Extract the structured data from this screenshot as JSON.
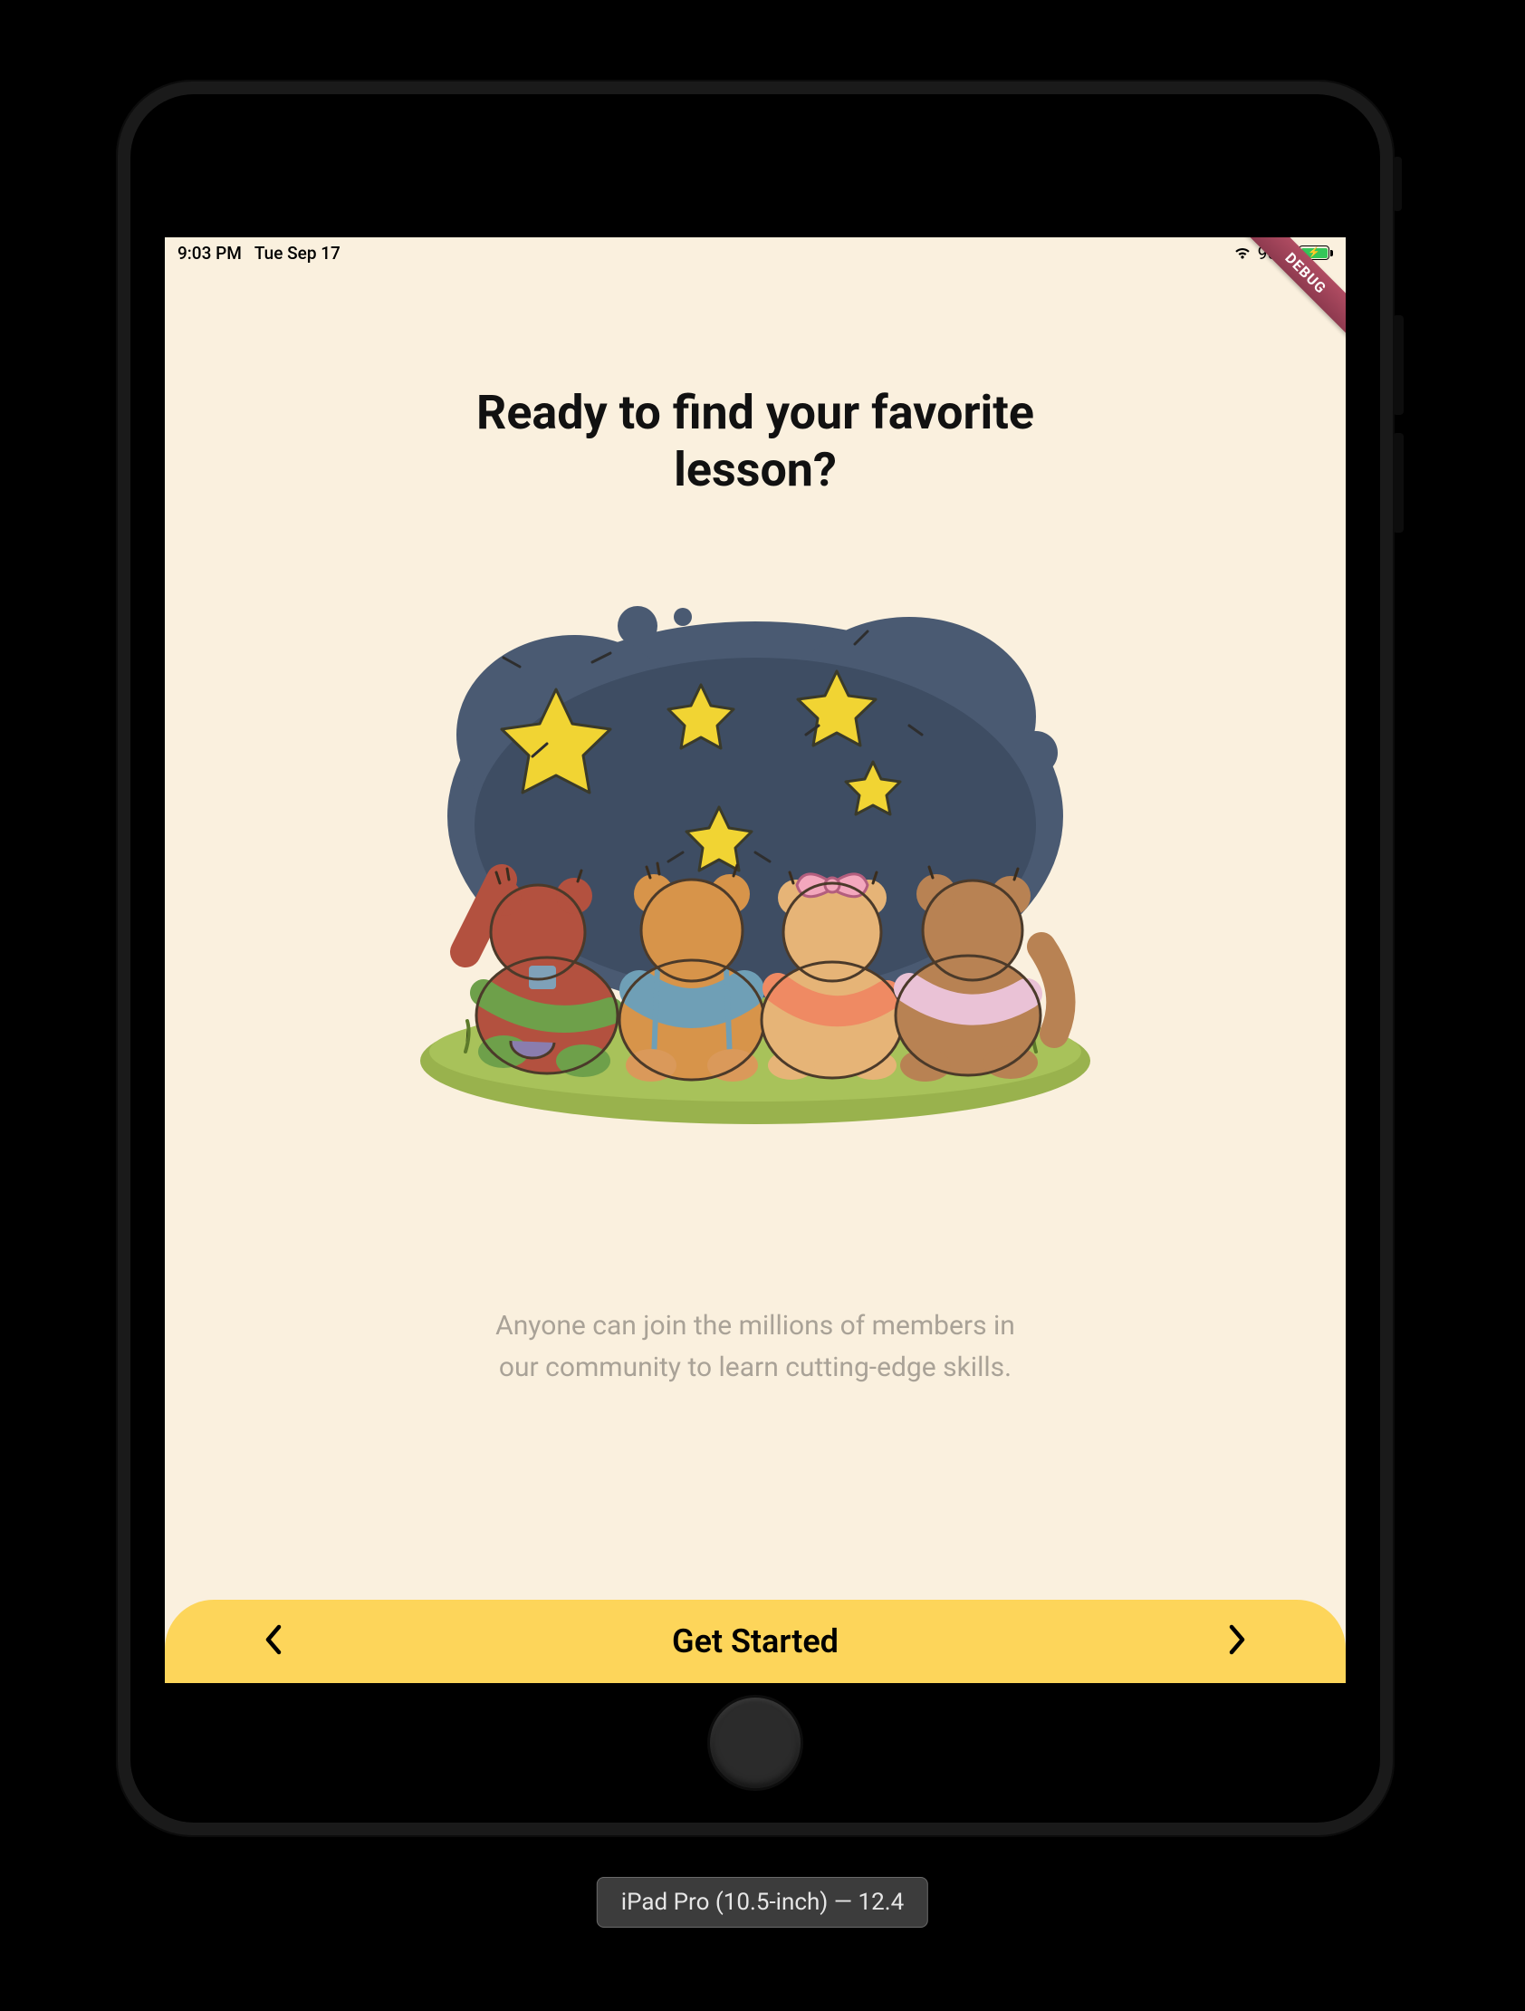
{
  "status": {
    "time": "9:03 PM",
    "date": "Tue Sep 17",
    "battery_percent": "96%"
  },
  "debug_ribbon": "DEBUG",
  "onboarding": {
    "title": "Ready to find your favorite lesson?",
    "subtitle": "Anyone can join the millions of members in our community to learn cutting-edge skills.",
    "cta_label": "Get Started"
  },
  "colors": {
    "screen_bg": "#faf0de",
    "cta_bg": "#fdd55a",
    "subtitle_text": "#a9a297",
    "night_sky": "#4a5a72",
    "star": "#f1d433",
    "grass": "#99b24d"
  },
  "simulator_label": "iPad Pro (10.5-inch) — 12.4"
}
